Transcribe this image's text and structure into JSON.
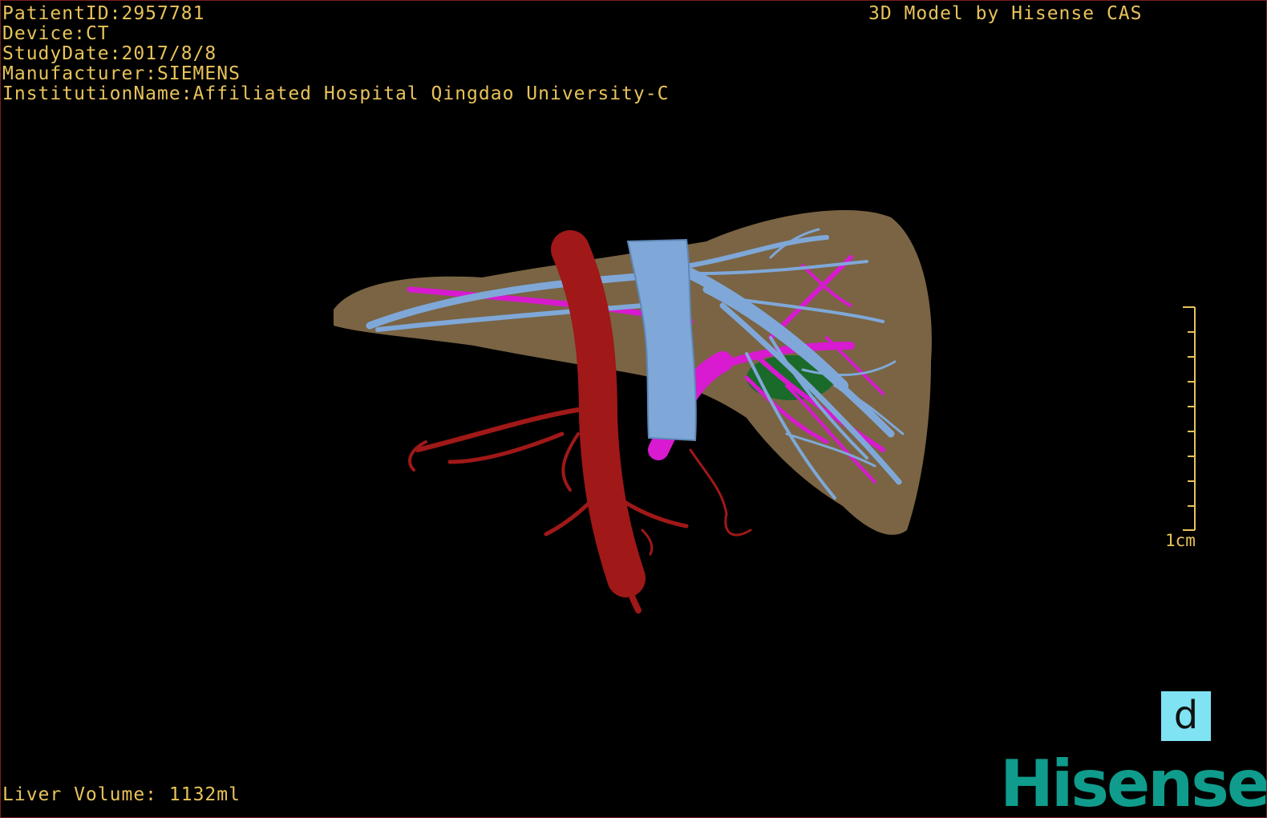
{
  "patient": {
    "id_label": "PatientID:",
    "id_value": "2957781",
    "device_label": "Device:",
    "device_value": "CT",
    "study_label": "StudyDate:",
    "study_value": "2017/8/8",
    "manufacturer_label": "Manufacturer:",
    "manufacturer_value": "SIEMENS",
    "institution_label": "InstitutionName:",
    "institution_value": "Affiliated Hospital Qingdao University-C"
  },
  "model_credit": "3D Model by Hisense CAS",
  "volume": {
    "label": "Liver Volume:",
    "value": "1132ml"
  },
  "scale": {
    "label": "1cm"
  },
  "orientation_label": "d",
  "brand": "Hisense",
  "colors": {
    "overlay_text": "#e8c35a",
    "liver": "#7a6444",
    "aorta": "#a01818",
    "vena_cava": "#7fa8d8",
    "portal_vein": "#d81ad0",
    "gallbladder": "#1a6a2a",
    "orientation_box": "#7fe3f3",
    "brand": "#0f9c8c"
  },
  "structures": [
    "liver",
    "aorta",
    "inferior-vena-cava",
    "hepatic-veins",
    "portal-vein",
    "gallbladder"
  ]
}
